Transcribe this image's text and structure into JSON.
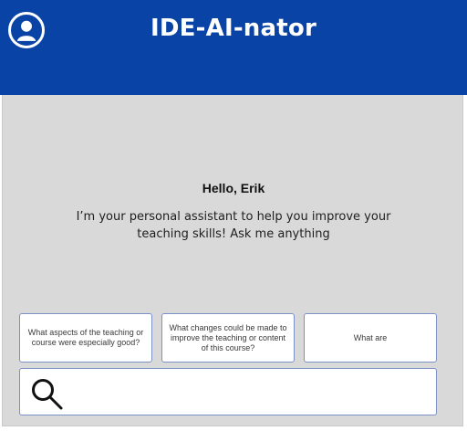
{
  "header": {
    "title": "IDE-AI-nator",
    "avatar_icon": "user-avatar-icon",
    "background_color": "#0a43a6"
  },
  "main": {
    "greeting": "Hello, Erik",
    "intro": "I’m your personal assistant to help you improve your teaching skills! Ask me anything",
    "background_color": "#d9d9d9"
  },
  "suggestions": [
    {
      "label": "What aspects of the teaching or course were especially good?"
    },
    {
      "label": "What changes could be made to improve the teaching or content of this course?"
    },
    {
      "label": "What are"
    }
  ],
  "search": {
    "icon": "search-icon",
    "value": "",
    "placeholder": ""
  }
}
